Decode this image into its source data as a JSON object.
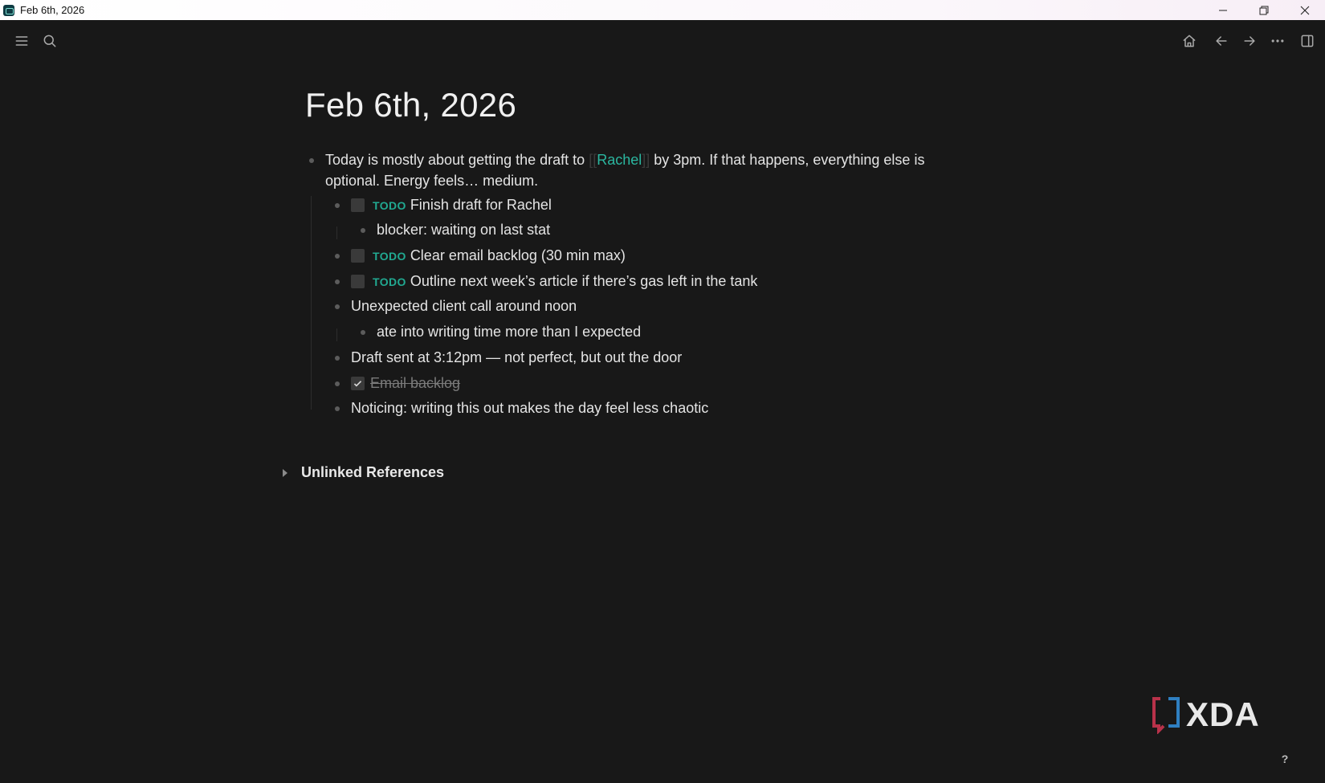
{
  "window": {
    "title": "Feb 6th, 2026",
    "controls": [
      "minimize-icon",
      "restore-icon",
      "close-icon"
    ]
  },
  "toolbar": {
    "left_icons": [
      "menu-icon",
      "search-icon"
    ],
    "right_icons": [
      "home-icon",
      "back-arrow-icon",
      "forward-arrow-icon",
      "more-icon",
      "sidebar-icon"
    ]
  },
  "page": {
    "title": "Feb 6th, 2026",
    "intro_before": "Today is mostly about getting the draft to ",
    "intro_ref_open": "[[",
    "intro_ref": "Rachel",
    "intro_ref_close": "]]",
    "intro_after": " by 3pm. If that happens, everything else is",
    "intro_line2": "optional. Energy feels… medium.",
    "todo_marker": "TODO",
    "todo1": "Finish draft for Rachel",
    "todo1_child": "blocker: waiting on last stat",
    "todo2": "Clear email backlog (30 min max)",
    "todo3": "Outline next week’s article if there’s gas left in the tank",
    "note1": "Unexpected client call around noon",
    "note1_child": "ate into writing time more than I expected",
    "note2": "Draft sent at 3:12pm — not perfect, but out the door",
    "done1": "Email backlog",
    "note3": "Noticing: writing this out makes the day feel less chaotic"
  },
  "references": {
    "unlinked_label": "Unlinked References"
  },
  "watermark": {
    "text": "XDA"
  },
  "help": {
    "label": "?"
  },
  "colors": {
    "background": "#181818",
    "accent": "#2bb7a0",
    "todo": "#21a991"
  }
}
